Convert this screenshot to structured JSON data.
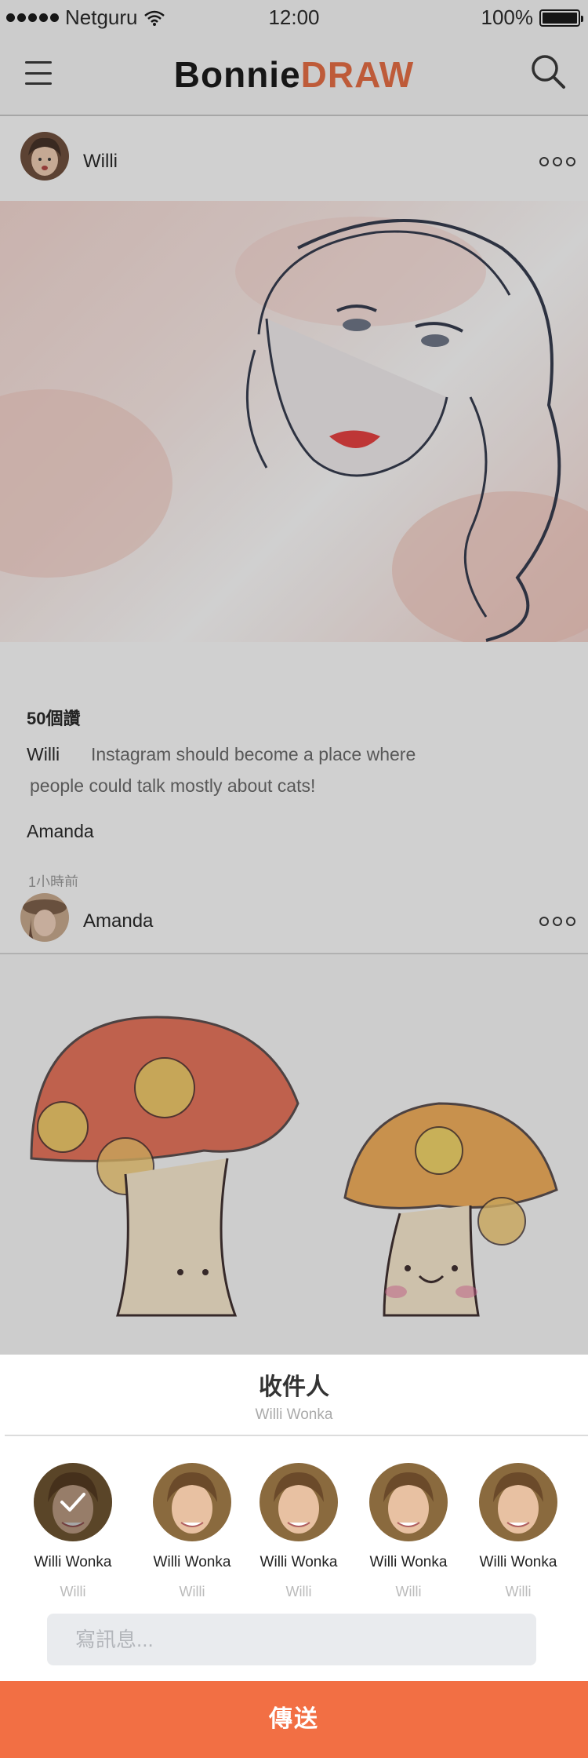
{
  "status_bar": {
    "carrier": "Netguru",
    "time": "12:00",
    "battery": "100%"
  },
  "nav": {
    "logo_part1": "Bonnie",
    "logo_part2": "DRAW",
    "icons": [
      "menu-icon",
      "search-icon"
    ]
  },
  "posts": [
    {
      "author": "Willi",
      "image": "woman-sketch-illustration",
      "likes": "50個讚",
      "caption_author": "Willi",
      "caption_line1": "Instagram should become a place where",
      "caption_line2": "people could talk mostly about cats!",
      "comment_author": "Amanda",
      "time_ago": "1小時前"
    },
    {
      "author": "Amanda",
      "image": "mushroom-crayon-illustration"
    }
  ],
  "share_sheet": {
    "title": "收件人",
    "subtitle": "Willi Wonka",
    "recipients": [
      {
        "name": "Willi Wonka",
        "handle": "Willi",
        "selected": true
      },
      {
        "name": "Willi Wonka",
        "handle": "Willi",
        "selected": false
      },
      {
        "name": "Willi Wonka",
        "handle": "Willi",
        "selected": false
      },
      {
        "name": "Willi Wonka",
        "handle": "Willi",
        "selected": false
      },
      {
        "name": "Willi Wonka",
        "handle": "Willi",
        "selected": false
      }
    ],
    "message_placeholder": "寫訊息...",
    "send_label": "傳送"
  },
  "colors": {
    "accent": "#f26f44",
    "logo_accent": "#e8693e"
  }
}
